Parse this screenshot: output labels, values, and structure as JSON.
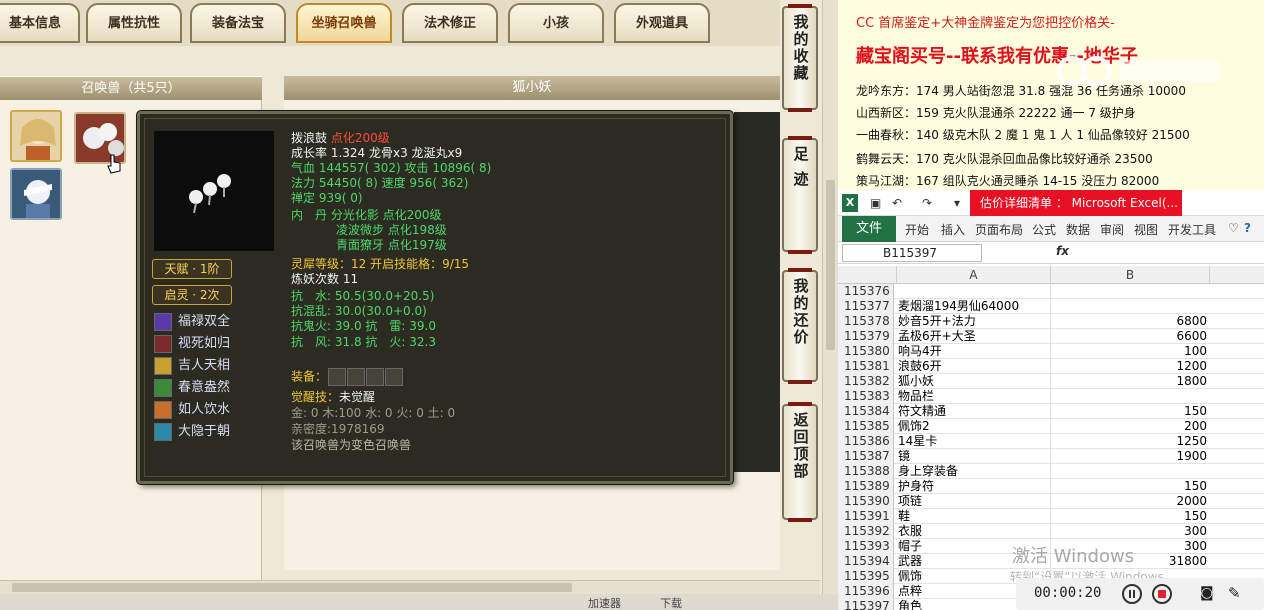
{
  "tabs": [
    "基本信息",
    "属性抗性",
    "装备法宝",
    "坐骑召唤兽",
    "法术修正",
    "小孩",
    "外观道具"
  ],
  "active_tab_index": 3,
  "pets_header": "召唤兽（共5只）",
  "pet_name_header": "狐小妖",
  "side_buttons": [
    "我的收藏",
    "足迹",
    "我的还价",
    "返回顶部"
  ],
  "status_texts": [
    "加速器",
    "下载"
  ],
  "tooltip": {
    "name": "拨浪鼓",
    "name_suffix": "点化200级",
    "growth_line": "成长率 1.324 龙骨x3 龙涎丸x9",
    "hp_line": "气血 144557( 302) 攻击 10896( 8)",
    "mp_line": "法力 54450( 8) 速度 956( 362)",
    "dingding_line": "禅定 939( 0)",
    "inner_line": "内　丹 分光化影 点化200级",
    "inner_line2": "凌波微步 点化198级",
    "inner_line3": "青面獠牙 点化197级",
    "spirit_line": "灵犀等级：12 开启技能格：9/15",
    "refine_line": "炼妖次数 11",
    "resist1": "抗　水: 50.5(30.0+20.5)",
    "resist2": "抗混乱: 30.0(30.0+0.0)",
    "resist3": "抗鬼火: 39.0 抗　雷: 39.0",
    "resist4": "抗　风: 31.8 抗　火: 32.3",
    "equip_label": "装备：",
    "awaken_label": "觉醒技：",
    "awaken_value": "未觉醒",
    "elements_line": "金: 0 木:100 水: 0 火: 0 土: 0",
    "intimacy_line": "亲密度:1978169",
    "variant_line": "该召唤兽为变色召唤兽",
    "badges": [
      "天赋 · 1阶",
      "启灵 · 2次"
    ],
    "skills": [
      "福禄双全",
      "视死如归",
      "吉人天相",
      "春意盎然",
      "如人饮水",
      "大隐于朝"
    ]
  },
  "paste_lines": {
    "top": "CC 首席鉴定+大神金牌鉴定为您把控价格关-",
    "headline": "藏宝阁买号--联系我有优惠--地华子",
    "l1": "龙吟东方：174 男人站街忽混 31.8 强混 36 任务通杀 10000",
    "l2": "山西新区：159 克火队混通杀 22222 通一 7 级护身",
    "l3": "一曲春秋：140 级克木队 2 魔 1 鬼 1 人 1 仙品像较好 21500",
    "l4": "鹤舞云天：170 克火队混杀回血品像比较好通杀 23500",
    "l5": "策马江湖：167 组队克火通灵睡杀 14-15 没压力 82000"
  },
  "excel": {
    "title": "估价详细清单 ： Microsoft Excel(...",
    "file_tab": "文件",
    "ribbon_tabs": [
      "开始",
      "插入",
      "页面布局",
      "公式",
      "数据",
      "审阅",
      "视图",
      "开发工具"
    ],
    "name_box": "B115397",
    "fx": "fx",
    "col_a": "A",
    "col_b": "B",
    "rows": [
      {
        "n": "115376",
        "a": "",
        "b": ""
      },
      {
        "n": "115377",
        "a": "麦烟溜194男仙64000",
        "b": ""
      },
      {
        "n": "115378",
        "a": "妙音5开+法力",
        "b": "6800"
      },
      {
        "n": "115379",
        "a": "孟极6开+大圣",
        "b": "6600"
      },
      {
        "n": "115380",
        "a": "响马4开",
        "b": "100"
      },
      {
        "n": "115381",
        "a": "浪鼓6开",
        "b": "1200"
      },
      {
        "n": "115382",
        "a": "狐小妖",
        "b": "1800"
      },
      {
        "n": "115383",
        "a": "物品栏",
        "b": ""
      },
      {
        "n": "115384",
        "a": "符文精通",
        "b": "150"
      },
      {
        "n": "115385",
        "a": "佩饰2",
        "b": "200"
      },
      {
        "n": "115386",
        "a": "14星卡",
        "b": "1250"
      },
      {
        "n": "115387",
        "a": "镜",
        "b": "1900"
      },
      {
        "n": "115388",
        "a": "身上穿装备",
        "b": ""
      },
      {
        "n": "115389",
        "a": "护身符",
        "b": "150"
      },
      {
        "n": "115390",
        "a": "项链",
        "b": "2000"
      },
      {
        "n": "115391",
        "a": "鞋",
        "b": "150"
      },
      {
        "n": "115392",
        "a": "衣服",
        "b": "300"
      },
      {
        "n": "115393",
        "a": "帽子",
        "b": "300"
      },
      {
        "n": "115394",
        "a": "武器",
        "b": "31800"
      },
      {
        "n": "115395",
        "a": "佩饰",
        "b": ""
      },
      {
        "n": "115396",
        "a": "点粹",
        "b": ""
      },
      {
        "n": "115397",
        "a": "角色",
        "b": ""
      }
    ]
  },
  "windows_watermark": "激活 Windows",
  "windows_watermark_sub": "转到“设置”以激活 Windows。",
  "recorder_time": "00:00:20"
}
